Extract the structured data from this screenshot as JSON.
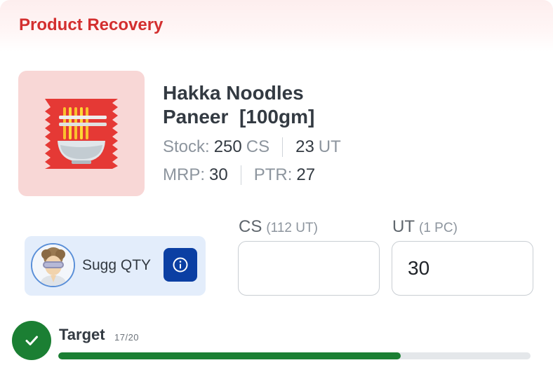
{
  "header": {
    "title": "Product Recovery"
  },
  "product": {
    "image_icon": "noodle-packet-icon",
    "name_line1": "Hakka Noodles",
    "name_line2": "Paneer  [100gm]",
    "stock_label": "Stock:",
    "stock_cs_value": "250",
    "stock_cs_unit": "CS",
    "stock_ut_value": "23",
    "stock_ut_unit": "UT",
    "mrp_label": "MRP:",
    "mrp_value": "30",
    "ptr_label": "PTR:",
    "ptr_value": "27"
  },
  "suggestion": {
    "label": "Sugg QTY",
    "avatar_icon": "assistant-avatar-icon",
    "info_icon": "info-icon"
  },
  "quantity": {
    "cs_label": "CS",
    "cs_sub": "(112 UT)",
    "cs_value": "",
    "ut_label": "UT",
    "ut_sub": "(1 PC)",
    "ut_value": "30"
  },
  "target": {
    "label": "Target",
    "count_text": "17/20",
    "progress_fraction": 0.725,
    "check_icon": "check-icon"
  },
  "colors": {
    "brand_red": "#d32f2f",
    "success_green": "#1b7f33",
    "info_blue": "#0b3fa3",
    "sugg_bg": "#e3edfb",
    "image_bg": "#f8d7d6"
  }
}
